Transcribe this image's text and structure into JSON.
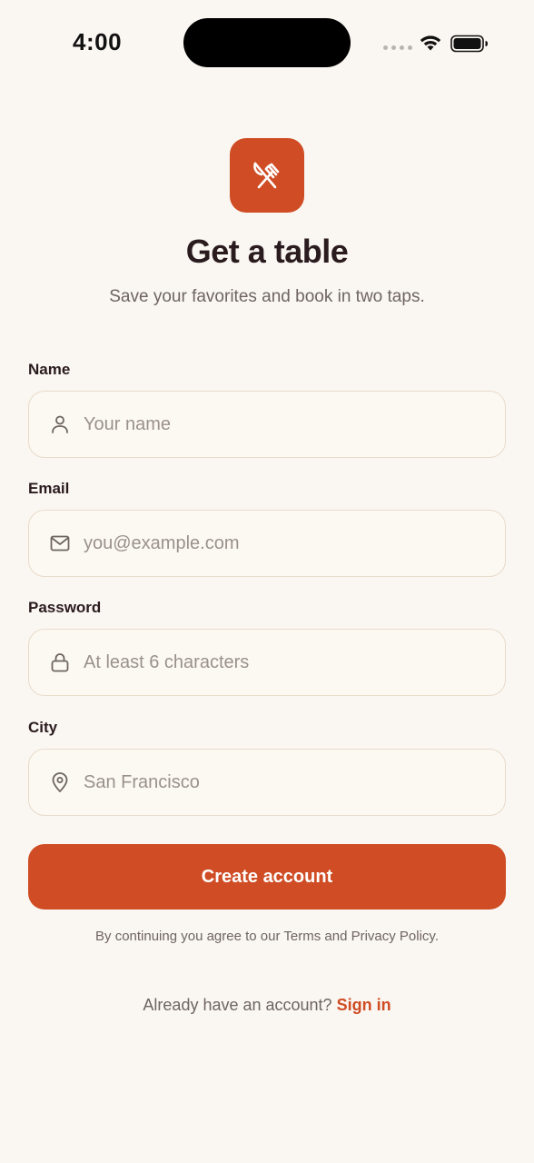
{
  "status_bar": {
    "time": "4:00"
  },
  "header": {
    "logo_icon": "fork-knife-icon",
    "title": "Get a table",
    "subtitle": "Save your favorites and book in two taps."
  },
  "form": {
    "name": {
      "label": "Name",
      "placeholder": "Your name",
      "value": "",
      "icon": "person-icon"
    },
    "email": {
      "label": "Email",
      "placeholder": "you@example.com",
      "value": "",
      "icon": "mail-icon"
    },
    "password": {
      "label": "Password",
      "placeholder": "At least 6 characters",
      "value": "",
      "icon": "lock-icon"
    },
    "city": {
      "label": "City",
      "placeholder": "San Francisco",
      "value": "",
      "icon": "location-pin-icon"
    },
    "submit_label": "Create account",
    "terms": "By continuing you agree to our Terms and Privacy Policy."
  },
  "footer": {
    "prompt": "Already have an account?",
    "signin_label": "Sign in"
  },
  "colors": {
    "accent": "#CF4C24",
    "background": "#FAF6F1",
    "text": "#2A1B1F",
    "muted": "#6E6562"
  }
}
